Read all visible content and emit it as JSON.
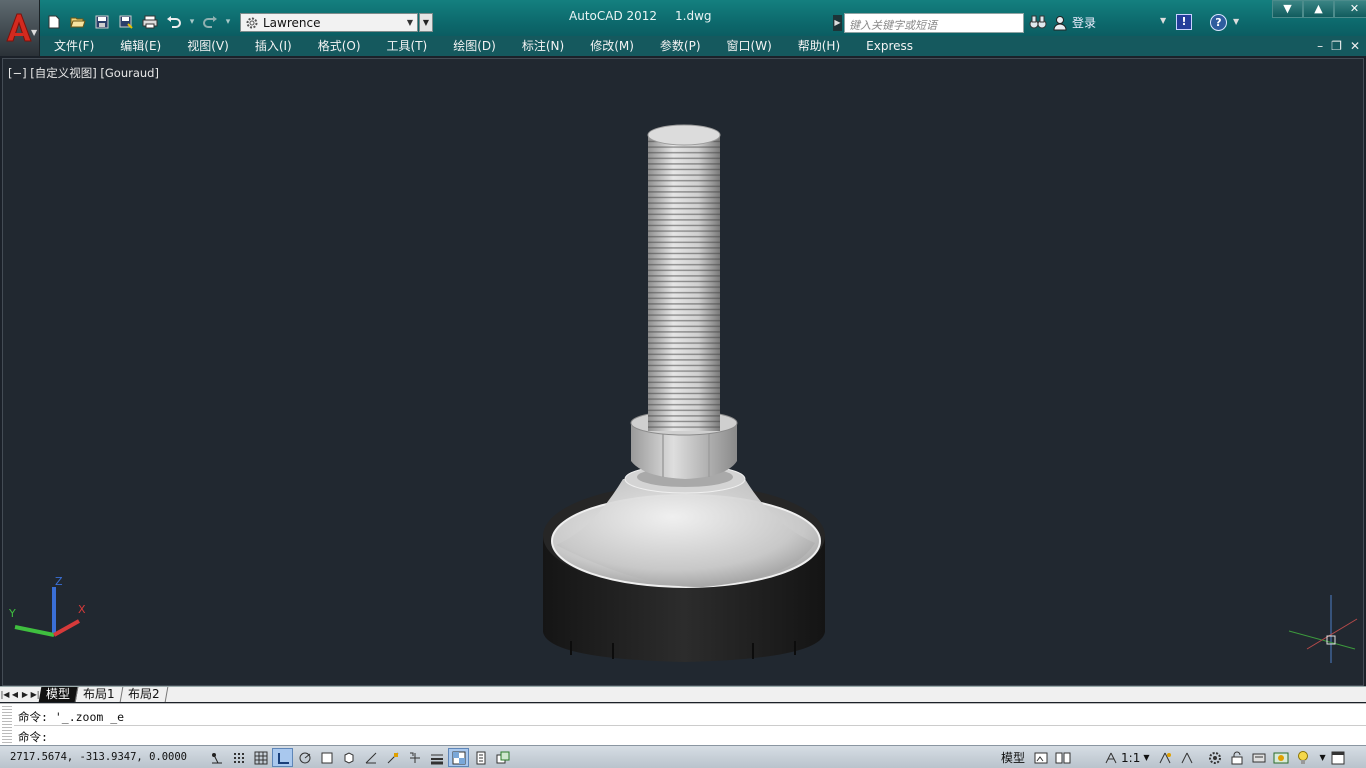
{
  "titlebar": {
    "app_name": "AutoCAD 2012",
    "file_name": "1.dwg",
    "workspace": "Lawrence",
    "search_placeholder": "键入关键字或短语",
    "login_label": "登录",
    "help_symbol": "?",
    "xchange_symbol": "!"
  },
  "menubar": {
    "items": [
      {
        "label": "文件(F)"
      },
      {
        "label": "编辑(E)"
      },
      {
        "label": "视图(V)"
      },
      {
        "label": "插入(I)"
      },
      {
        "label": "格式(O)"
      },
      {
        "label": "工具(T)"
      },
      {
        "label": "绘图(D)"
      },
      {
        "label": "标注(N)"
      },
      {
        "label": "修改(M)"
      },
      {
        "label": "参数(P)"
      },
      {
        "label": "窗口(W)"
      },
      {
        "label": "帮助(H)"
      },
      {
        "label": "Express"
      }
    ]
  },
  "viewport": {
    "label": "[−] [自定义视图] [Gouraud]",
    "ucs_axes": {
      "x": "X",
      "y": "Y",
      "z": "Z"
    }
  },
  "tabs": {
    "items": [
      {
        "label": "模型",
        "active": true
      },
      {
        "label": "布局1",
        "active": false
      },
      {
        "label": "布局2",
        "active": false
      }
    ]
  },
  "command": {
    "history_line": "命令: '_.zoom _e",
    "prompt": "命令:"
  },
  "statusbar": {
    "coordinates": "2717.5674, -313.9347, 0.0000",
    "model_label": "模型",
    "annotation_scale": "1:1",
    "toggles": [
      {
        "name": "infer-constraints",
        "on": false
      },
      {
        "name": "snap-mode",
        "on": false
      },
      {
        "name": "grid-display",
        "on": false
      },
      {
        "name": "ortho-mode",
        "on": true
      },
      {
        "name": "polar-tracking",
        "on": false
      },
      {
        "name": "object-snap",
        "on": false
      },
      {
        "name": "3d-object-snap",
        "on": false
      },
      {
        "name": "object-snap-tracking",
        "on": false
      },
      {
        "name": "dynamic-ucs",
        "on": false
      },
      {
        "name": "dynamic-input",
        "on": false
      },
      {
        "name": "lineweight",
        "on": false
      },
      {
        "name": "transparency",
        "on": true
      },
      {
        "name": "quick-properties",
        "on": false
      },
      {
        "name": "selection-cycling",
        "on": false
      }
    ]
  },
  "colors": {
    "titlebar": "#0d6a6d",
    "menubar": "#15595e",
    "viewport_bg": "#212830",
    "axis_x": "#d63a3a",
    "axis_y": "#3fbf3f",
    "axis_z": "#3a6fd6"
  }
}
